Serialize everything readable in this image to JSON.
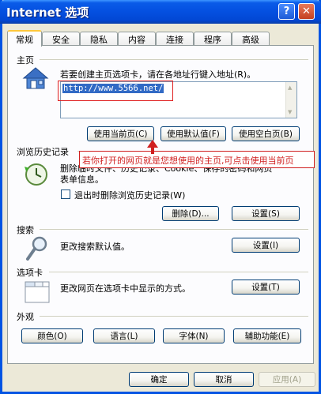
{
  "window": {
    "title": "Internet 选项",
    "help_icon": "?",
    "close_icon": "✕"
  },
  "tabs": [
    "常规",
    "安全",
    "隐私",
    "内容",
    "连接",
    "程序",
    "高级"
  ],
  "homepage": {
    "group_title": "主页",
    "description": "若要创建主页选项卡，请在各地址行键入地址(R)。",
    "url": "http://www.5566.net/",
    "buttons": {
      "use_current": "使用当前页(C)",
      "use_default": "使用默认值(F)",
      "use_blank": "使用空白页(B)"
    }
  },
  "annotation": "若你打开的网页就是您想使用的主页,可点击使用当前页",
  "history": {
    "group_title": "浏览历史记录",
    "description_line1": "删除临时文件、历史记录、Cookie、保存的密码和网页",
    "description_line2": "表单信息。",
    "checkbox_label": "退出时删除浏览历史记录(W)",
    "delete_button": "删除(D)...",
    "settings_button": "设置(S)"
  },
  "search": {
    "group_title": "搜索",
    "description": "更改搜索默认值。",
    "settings_button": "设置(I)"
  },
  "tabs_group": {
    "group_title": "选项卡",
    "description": "更改网页在选项卡中显示的方式。",
    "settings_button": "设置(T)"
  },
  "appearance": {
    "group_title": "外观",
    "colors": "颜色(O)",
    "languages": "语言(L)",
    "fonts": "字体(N)",
    "accessibility": "辅助功能(E)"
  },
  "footer": {
    "ok": "确定",
    "cancel": "取消",
    "apply": "应用(A)"
  },
  "colors": {
    "title_bar": "#0450e0",
    "dialog": "#ece9d8",
    "annotation": "#d02020",
    "selection": "#316ac5"
  }
}
